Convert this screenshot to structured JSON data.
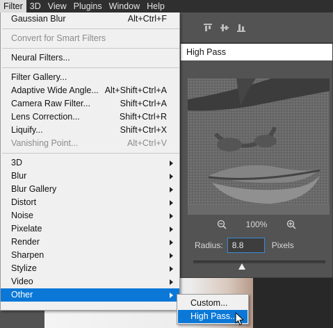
{
  "menubar": {
    "items": [
      "Filter",
      "3D",
      "View",
      "Plugins",
      "Window",
      "Help"
    ],
    "active": "Filter"
  },
  "filter_menu": {
    "items": [
      {
        "label": "Gaussian Blur",
        "shortcut": "Alt+Ctrl+F",
        "enabled": true,
        "submenu": false
      },
      {
        "separator": true
      },
      {
        "label": "Convert for Smart Filters",
        "shortcut": "",
        "enabled": false,
        "submenu": false
      },
      {
        "separator": true
      },
      {
        "label": "Neural Filters...",
        "shortcut": "",
        "enabled": true,
        "submenu": false
      },
      {
        "separator": true
      },
      {
        "label": "Filter Gallery...",
        "shortcut": "",
        "enabled": true,
        "submenu": false
      },
      {
        "label": "Adaptive Wide Angle...",
        "shortcut": "Alt+Shift+Ctrl+A",
        "enabled": true,
        "submenu": false
      },
      {
        "label": "Camera Raw Filter...",
        "shortcut": "Shift+Ctrl+A",
        "enabled": true,
        "submenu": false
      },
      {
        "label": "Lens Correction...",
        "shortcut": "Shift+Ctrl+R",
        "enabled": true,
        "submenu": false
      },
      {
        "label": "Liquify...",
        "shortcut": "Shift+Ctrl+X",
        "enabled": true,
        "submenu": false
      },
      {
        "label": "Vanishing Point...",
        "shortcut": "Alt+Ctrl+V",
        "enabled": false,
        "submenu": false
      },
      {
        "separator": true
      },
      {
        "label": "3D",
        "shortcut": "",
        "enabled": true,
        "submenu": true
      },
      {
        "label": "Blur",
        "shortcut": "",
        "enabled": true,
        "submenu": true
      },
      {
        "label": "Blur Gallery",
        "shortcut": "",
        "enabled": true,
        "submenu": true
      },
      {
        "label": "Distort",
        "shortcut": "",
        "enabled": true,
        "submenu": true
      },
      {
        "label": "Noise",
        "shortcut": "",
        "enabled": true,
        "submenu": true
      },
      {
        "label": "Pixelate",
        "shortcut": "",
        "enabled": true,
        "submenu": true
      },
      {
        "label": "Render",
        "shortcut": "",
        "enabled": true,
        "submenu": true
      },
      {
        "label": "Sharpen",
        "shortcut": "",
        "enabled": true,
        "submenu": true
      },
      {
        "label": "Stylize",
        "shortcut": "",
        "enabled": true,
        "submenu": true
      },
      {
        "label": "Video",
        "shortcut": "",
        "enabled": true,
        "submenu": true
      },
      {
        "label": "Other",
        "shortcut": "",
        "enabled": true,
        "submenu": true,
        "highlight": true
      }
    ]
  },
  "other_submenu": {
    "items": [
      {
        "label": "Custom...",
        "highlight": false
      },
      {
        "label": "High Pass...",
        "highlight": true
      }
    ]
  },
  "dialog": {
    "title": "High Pass",
    "zoom": "100%",
    "radius_label": "Radius:",
    "radius_value": "8.8",
    "unit": "Pixels",
    "slider_position": 0.37
  },
  "icons": {
    "zoom_out": "zoom-out-icon",
    "zoom_in": "zoom-in-icon",
    "submenu_arrow": "chevron-right-icon",
    "cursor": "mouse-pointer-icon"
  },
  "colors": {
    "highlight": "#0b78d7",
    "menu_bg": "#f0f0f0",
    "dialog_bg": "#535353",
    "input_border": "#3b8ad6"
  }
}
